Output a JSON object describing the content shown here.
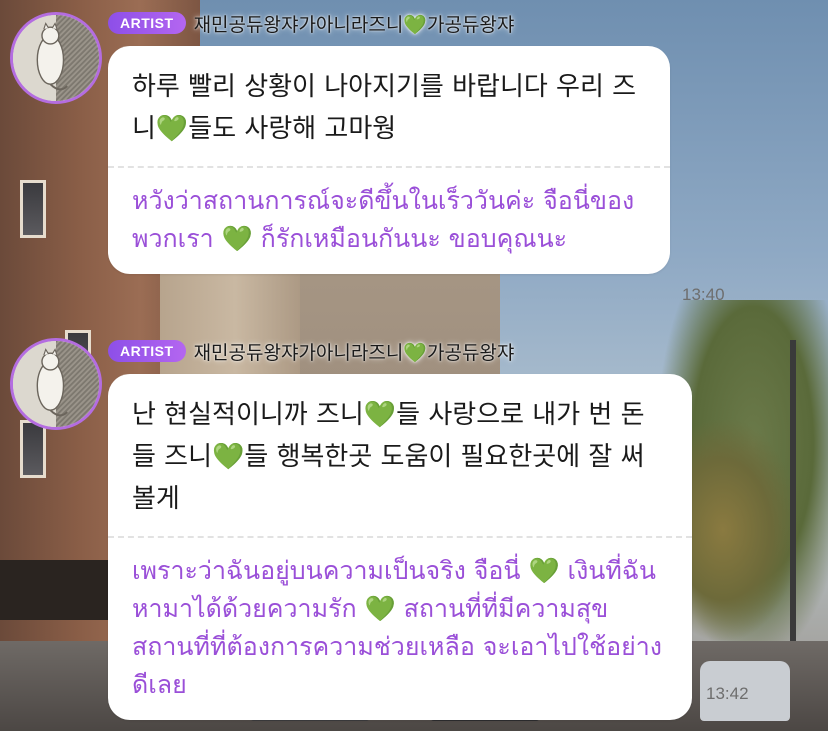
{
  "messages": [
    {
      "badge": "ARTIST",
      "sender": "재민공듀왕쟈가아니라즈니💚가공듀왕쟈",
      "original": "하루 빨리 상황이 나아지기를 바랍니다 우리 즈니💚들도 사랑해 고마웡",
      "translation": "หวังว่าสถานการณ์จะดีขึ้นในเร็ววันค่ะ จือนี่ของพวกเรา 💚 ก็รักเหมือนกันนะ ขอบคุณนะ",
      "time": "13:40"
    },
    {
      "badge": "ARTIST",
      "sender": "재민공듀왕쟈가아니라즈니💚가공듀왕쟈",
      "original": "난 현실적이니까 즈니💚들 사랑으로 내가 번 돈들 즈니💚들 행복한곳 도움이 필요한곳에 잘 써볼게",
      "translation": "เพราะว่าฉันอยู่บนความเป็นจริง จือนี่ 💚 เงินที่ฉันหามาได้ด้วยความรัก 💚 สถานที่ที่มีความสุข สถานที่ที่ต้องการความช่วยเหลือ จะเอาไปใช้อย่างดีเลย",
      "time": "13:42"
    }
  ],
  "colors": {
    "badge": "#a15bec",
    "translation_text": "#9a4fd8",
    "avatar_ring": "#b46de0",
    "bubble": "#ffffff"
  },
  "icons": [
    "artist-avatar",
    "green-heart-emoji"
  ]
}
